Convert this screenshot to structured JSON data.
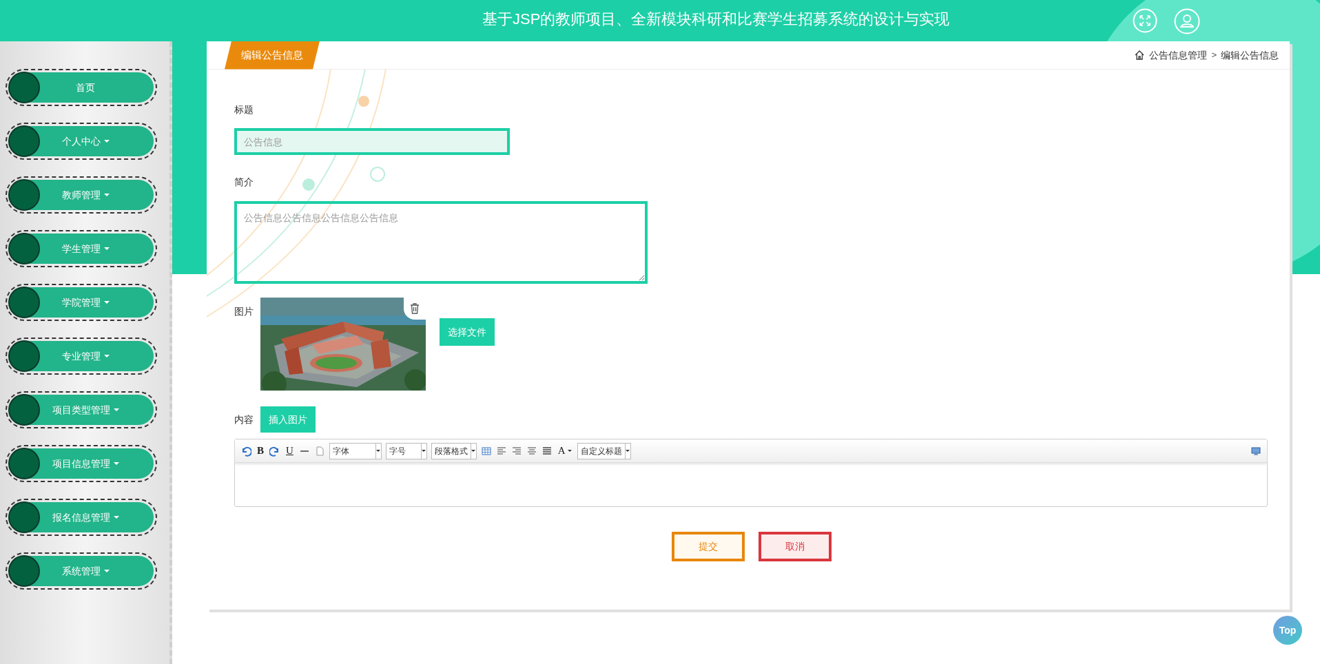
{
  "header": {
    "title": "基于JSP的教师项目、全新模块科研和比赛学生招募系统的设计与实现"
  },
  "sidebar": {
    "items": [
      {
        "label": "首页",
        "dropdown": false
      },
      {
        "label": "个人中心",
        "dropdown": true
      },
      {
        "label": "教师管理",
        "dropdown": true
      },
      {
        "label": "学生管理",
        "dropdown": true
      },
      {
        "label": "学院管理",
        "dropdown": true
      },
      {
        "label": "专业管理",
        "dropdown": true
      },
      {
        "label": "项目类型管理",
        "dropdown": true
      },
      {
        "label": "项目信息管理",
        "dropdown": true
      },
      {
        "label": "报名信息管理",
        "dropdown": true
      },
      {
        "label": "系统管理",
        "dropdown": true
      }
    ]
  },
  "page_tab": "编辑公告信息",
  "breadcrumb": [
    "公告信息管理",
    ">",
    "编辑公告信息"
  ],
  "form": {
    "title": {
      "label": "标题",
      "placeholder": "公告信息"
    },
    "intro": {
      "label": "简介",
      "placeholder": "公告信息公告信息公告信息公告信息"
    },
    "image": {
      "label": "图片",
      "button": "选择文件"
    },
    "content": {
      "label": "内容",
      "insert_button": "插入图片",
      "toolbar": [
        {
          "kind": "undo"
        },
        {
          "kind": "glyph",
          "label": "B"
        },
        {
          "kind": "redo"
        },
        {
          "kind": "glyph",
          "label": "U",
          "underline": true
        },
        {
          "kind": "rule"
        },
        {
          "kind": "page"
        },
        {
          "kind": "select",
          "label": "字体"
        },
        {
          "kind": "select",
          "label": "字号"
        },
        {
          "kind": "select",
          "label": "段落格式"
        },
        {
          "kind": "table"
        },
        {
          "kind": "align-left"
        },
        {
          "kind": "align-right"
        },
        {
          "kind": "align-center"
        },
        {
          "kind": "justify"
        },
        {
          "kind": "glyph",
          "label": "A",
          "caret": true
        },
        {
          "kind": "select",
          "label": "自定义标题"
        },
        {
          "kind": "preview"
        }
      ]
    }
  },
  "buttons": [
    {
      "label": "提交",
      "kind": "submit"
    },
    {
      "label": "取消",
      "kind": "cancel"
    }
  ],
  "top_button": "Top"
}
